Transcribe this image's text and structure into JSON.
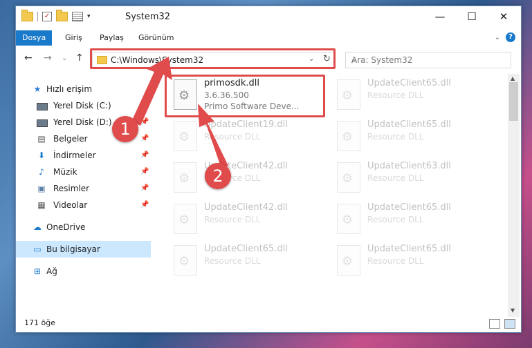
{
  "window": {
    "title": "System32"
  },
  "ribbon": {
    "tabs": [
      "Dosya",
      "Giriş",
      "Paylaş",
      "Görünüm"
    ],
    "help": "?"
  },
  "nav": {
    "address": "C:\\Windows\\System32",
    "search_placeholder": "Ara: System32"
  },
  "sidebar": {
    "items": [
      {
        "label": "Hızlı erişim",
        "icon": "star-icon"
      },
      {
        "label": "Yerel Disk (C:)",
        "icon": "drive-icon"
      },
      {
        "label": "Yerel Disk (D:)",
        "icon": "drive-icon"
      },
      {
        "label": "Belgeler",
        "icon": "documents-icon"
      },
      {
        "label": "İndirmeler",
        "icon": "download-icon"
      },
      {
        "label": "Müzik",
        "icon": "music-icon"
      },
      {
        "label": "Resimler",
        "icon": "pictures-icon"
      },
      {
        "label": "Videolar",
        "icon": "video-icon"
      },
      {
        "label": "OneDrive",
        "icon": "cloud-icon"
      },
      {
        "label": "Bu bilgisayar",
        "icon": "computer-icon"
      },
      {
        "label": "Ağ",
        "icon": "network-icon"
      }
    ]
  },
  "files": {
    "main": {
      "name": "primosdk.dll",
      "version": "3.6.36.500",
      "company": "Primo Software Deve..."
    },
    "faded": [
      {
        "name": "UpdateClient65.dll",
        "type": "Resource DLL"
      },
      {
        "name": "UpdateClient19.dll",
        "type": "Resource DLL"
      },
      {
        "name": "UpdateClient65.dll",
        "type": "Resource DLL"
      },
      {
        "name": "UpdateClient42.dll",
        "type": "Resource DLL"
      },
      {
        "name": "UpdateClient63.dll",
        "type": "Resource DLL"
      },
      {
        "name": "UpdateClient42.dll",
        "type": "Resource DLL"
      },
      {
        "name": "UpdateClient65.dll",
        "type": "Resource DLL"
      },
      {
        "name": "UpdateClient65.dll",
        "type": "Resource DLL"
      },
      {
        "name": "UpdateClient65.dll",
        "type": "Resource DLL"
      }
    ]
  },
  "status": {
    "count": "171 öğe"
  },
  "callouts": [
    "1",
    "2"
  ],
  "colors": {
    "accent": "#1979ca",
    "highlight": "#e04b4b"
  }
}
